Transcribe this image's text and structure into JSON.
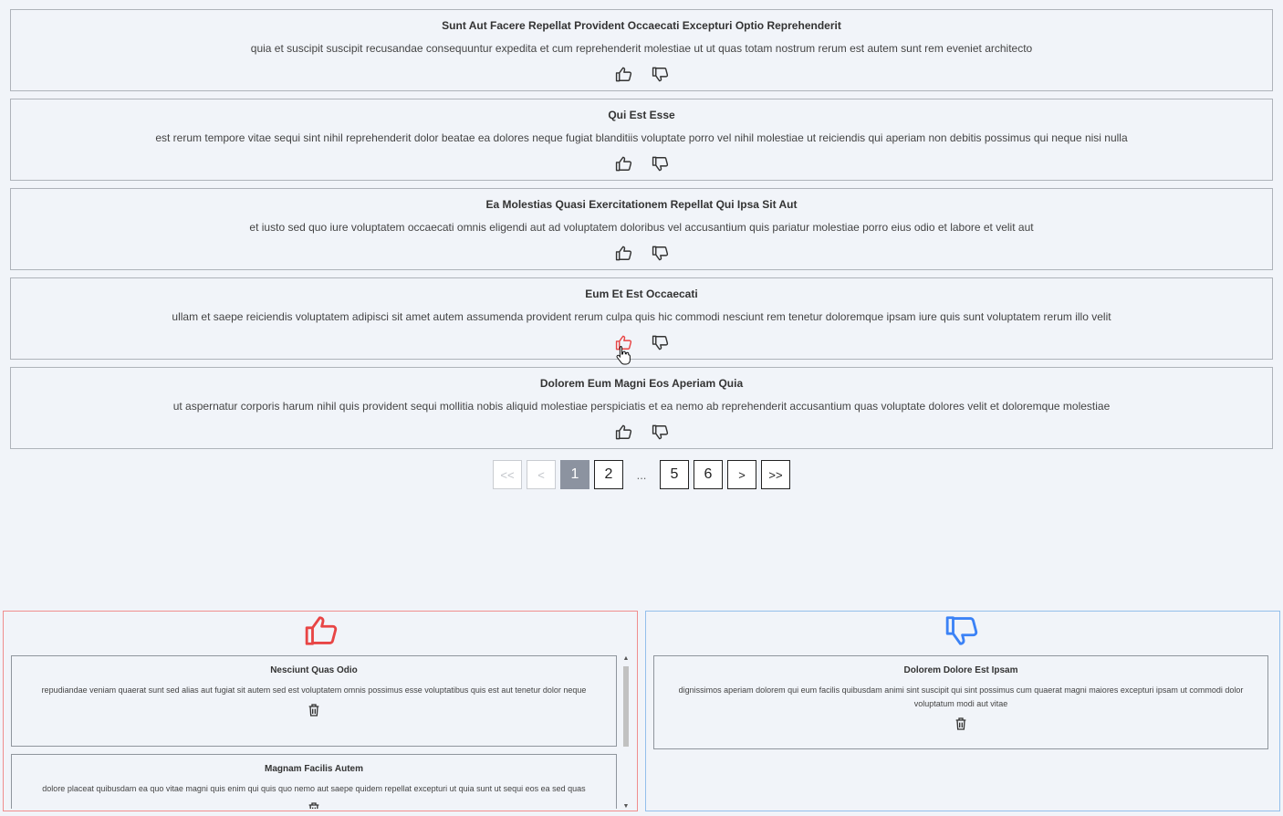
{
  "colors": {
    "liked": "#e84545",
    "disliked": "#3b82f6",
    "active_page": "#8c93a0"
  },
  "icons": {
    "like": "thumbs-up-icon",
    "dislike": "thumbs-down-icon",
    "delete": "trash-icon",
    "cursor": "hand-pointer-cursor-icon"
  },
  "posts": [
    {
      "title": "Sunt Aut Facere Repellat Provident Occaecati Excepturi Optio Reprehenderit",
      "body": "quia et suscipit suscipit recusandae consequuntur expedita et cum reprehenderit molestiae ut ut quas totam nostrum rerum est autem sunt rem eveniet architecto",
      "liked": false
    },
    {
      "title": "Qui Est Esse",
      "body": "est rerum tempore vitae sequi sint nihil reprehenderit dolor beatae ea dolores neque fugiat blanditiis voluptate porro vel nihil molestiae ut reiciendis qui aperiam non debitis possimus qui neque nisi nulla",
      "liked": false
    },
    {
      "title": "Ea Molestias Quasi Exercitationem Repellat Qui Ipsa Sit Aut",
      "body": "et iusto sed quo iure voluptatem occaecati omnis eligendi aut ad voluptatem doloribus vel accusantium quis pariatur molestiae porro eius odio et labore et velit aut",
      "liked": false
    },
    {
      "title": "Eum Et Est Occaecati",
      "body": "ullam et saepe reiciendis voluptatem adipisci sit amet autem assumenda provident rerum culpa quis hic commodi nesciunt rem tenetur doloremque ipsam iure quis sunt voluptatem rerum illo velit",
      "liked": true
    },
    {
      "title": "Dolorem Eum Magni Eos Aperiam Quia",
      "body": "ut aspernatur corporis harum nihil quis provident sequi mollitia nobis aliquid molestiae perspiciatis et ea nemo ab reprehenderit accusantium quas voluptate dolores velit et doloremque molestiae",
      "liked": false
    }
  ],
  "pagination": {
    "first": "<<",
    "prev": "<",
    "pages": [
      "1",
      "2"
    ],
    "ellipsis": "...",
    "pages_end": [
      "5",
      "6"
    ],
    "next": ">",
    "last": ">>",
    "current": "1"
  },
  "liked_panel": {
    "items": [
      {
        "title": "Nesciunt Quas Odio",
        "body": "repudiandae veniam quaerat sunt sed alias aut fugiat sit autem sed est voluptatem omnis possimus esse voluptatibus quis est aut tenetur dolor neque"
      },
      {
        "title": "Magnam Facilis Autem",
        "body": "dolore placeat quibusdam ea quo vitae magni quis enim qui quis quo nemo aut saepe quidem repellat excepturi ut quia sunt ut sequi eos ea sed quas"
      }
    ],
    "scroll_position": 0
  },
  "disliked_panel": {
    "items": [
      {
        "title": "Dolorem Dolore Est Ipsam",
        "body": "dignissimos aperiam dolorem qui eum facilis quibusdam animi sint suscipit qui sint possimus cum quaerat magni maiores excepturi ipsam ut commodi dolor voluptatum modi aut vitae"
      }
    ]
  }
}
